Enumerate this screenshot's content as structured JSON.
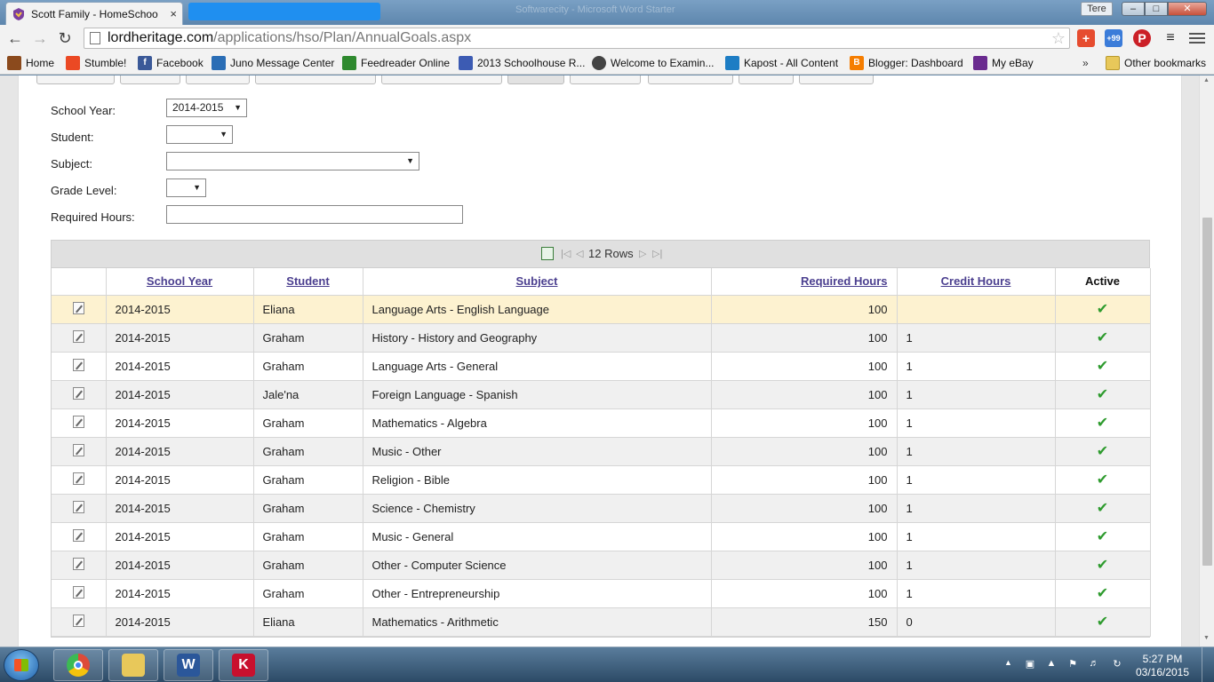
{
  "browser": {
    "tab_title": "Scott Family - HomeSchoo",
    "tab_close": "×",
    "window_title": "Softwarecity - Microsoft Word Starter",
    "profile_label": "Tere",
    "url_host": "lordheritage.com",
    "url_path": "/applications/hso/Plan/AnnualGoals.aspx",
    "ext_badge": "+99",
    "back": "←",
    "forward": "→",
    "reload": "↻",
    "star": "☆"
  },
  "bookmarks": {
    "items": [
      {
        "label": "Home",
        "color": "#8b4a1d"
      },
      {
        "label": "Stumble!",
        "color": "#eb4924"
      },
      {
        "label": "Facebook",
        "color": "#3b5998"
      },
      {
        "label": "Juno Message Center",
        "color": "#2a6db5"
      },
      {
        "label": "Feedreader Online",
        "color": "#2f8a2f"
      },
      {
        "label": "2013 Schoolhouse R...",
        "color": "#3c5bb3"
      },
      {
        "label": "Welcome to Examin...",
        "color": "#444444"
      },
      {
        "label": "Kapost - All Content",
        "color": "#1d7dc4"
      },
      {
        "label": "Blogger: Dashboard",
        "color": "#f57d00"
      },
      {
        "label": "My eBay",
        "color": "#6a2b8f"
      }
    ],
    "more": "»",
    "other": "Other bookmarks"
  },
  "form": {
    "school_year_label": "School Year:",
    "school_year_value": "2014-2015",
    "student_label": "Student:",
    "student_value": "",
    "subject_label": "Subject:",
    "subject_value": "",
    "grade_label": "Grade Level:",
    "grade_value": "",
    "hours_label": "Required Hours:",
    "hours_value": ""
  },
  "grid": {
    "rows_label": "12 Rows",
    "columns": [
      "School Year",
      "Student",
      "Subject",
      "Required Hours",
      "Credit Hours",
      "Active"
    ],
    "rows": [
      [
        "2014-2015",
        "Eliana",
        "Language Arts - English Language",
        "100",
        ""
      ],
      [
        "2014-2015",
        "Graham",
        "History - History and Geography",
        "100",
        "1"
      ],
      [
        "2014-2015",
        "Graham",
        "Language Arts - General",
        "100",
        "1"
      ],
      [
        "2014-2015",
        "Jale'na",
        "Foreign Language - Spanish",
        "100",
        "1"
      ],
      [
        "2014-2015",
        "Graham",
        "Mathematics - Algebra",
        "100",
        "1"
      ],
      [
        "2014-2015",
        "Graham",
        "Music - Other",
        "100",
        "1"
      ],
      [
        "2014-2015",
        "Graham",
        "Religion - Bible",
        "100",
        "1"
      ],
      [
        "2014-2015",
        "Graham",
        "Science - Chemistry",
        "100",
        "1"
      ],
      [
        "2014-2015",
        "Graham",
        "Music - General",
        "100",
        "1"
      ],
      [
        "2014-2015",
        "Graham",
        "Other - Computer Science",
        "100",
        "1"
      ],
      [
        "2014-2015",
        "Graham",
        "Other - Entrepreneurship",
        "100",
        "1"
      ],
      [
        "2014-2015",
        "Eliana",
        "Mathematics - Arithmetic",
        "150",
        "0"
      ]
    ],
    "active_mark": "✔"
  },
  "taskbar": {
    "time": "5:27 PM",
    "date": "03/16/2015",
    "apps": [
      {
        "name": "chrome",
        "color": "#dd4b39"
      },
      {
        "name": "explorer",
        "color": "#e8c85a"
      },
      {
        "name": "word",
        "color": "#2b579a",
        "glyph": "W"
      },
      {
        "name": "kaspersky",
        "color": "#c8102e",
        "glyph": "K"
      }
    ]
  },
  "colors": {
    "link": "#4b3f8f",
    "selected_row": "#fdf2d0",
    "check": "#2e9b2e"
  }
}
